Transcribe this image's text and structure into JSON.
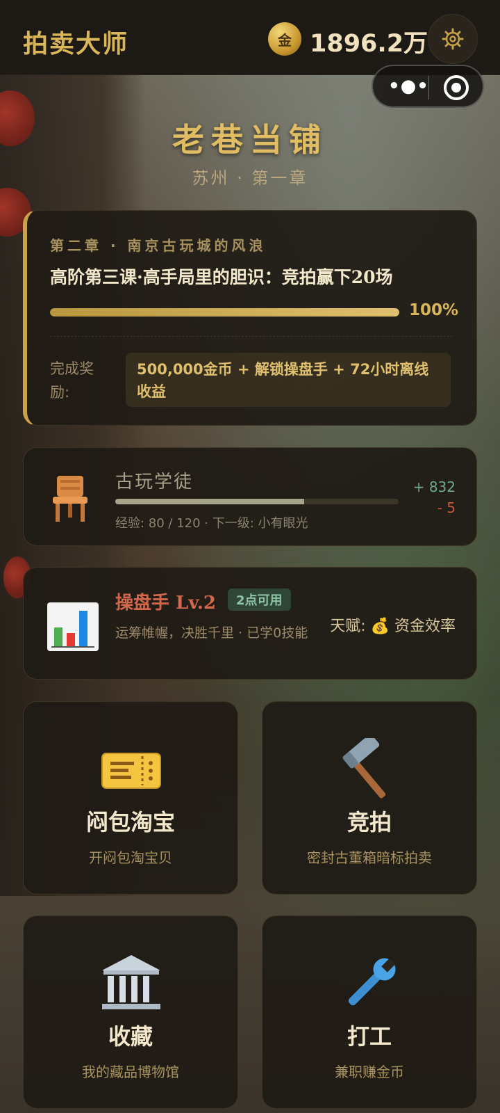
{
  "header": {
    "app_title": "拍卖大师",
    "coin_symbol": "金",
    "gold_amount": "1896.2万"
  },
  "location": {
    "title": "老巷当铺",
    "subtitle": "苏州 · 第一章"
  },
  "quest": {
    "chapter": "第二章 · 南京古玩城的风浪",
    "name": "高阶第三课·高手局里的胆识：竞拍赢下20场",
    "progress_pct": 100,
    "progress_text": "100%",
    "reward_label": "完成奖励:",
    "reward_text": "500,000金币 + 解锁操盘手 + 72小时离线收益"
  },
  "rank": {
    "icon": "chair-icon",
    "title": "古玩学徒",
    "exp_current": 80,
    "exp_max": 120,
    "exp_text": "经验: 80 / 120 · 下一级: 小有眼光",
    "plus": "+ 832",
    "minus": "- 5"
  },
  "trader": {
    "icon": "bar-chart-icon",
    "title": "操盘手 Lv.2",
    "badge": "2点可用",
    "desc": "运筹帷幄，决胜千里 · 已学0技能",
    "talent": "天赋: 💰 资金效率"
  },
  "tiles": [
    {
      "icon": "ticket-icon",
      "title": "闷包淘宝",
      "sub": "开闷包淘宝贝"
    },
    {
      "icon": "hammer-icon",
      "title": "竞拍",
      "sub": "密封古董箱暗标拍卖"
    },
    {
      "icon": "museum-icon",
      "title": "收藏",
      "sub": "我的藏品博物馆"
    },
    {
      "icon": "wrench-icon",
      "title": "打工",
      "sub": "兼职赚金币"
    }
  ],
  "colors": {
    "gold": "#d9b65a",
    "background": "#1d1914",
    "trader_red": "#d3674c",
    "badge_green": "#8ec3a3"
  }
}
